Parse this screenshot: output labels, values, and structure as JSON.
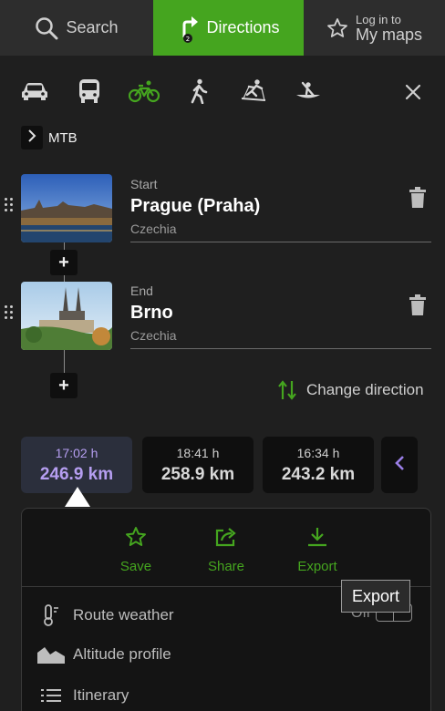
{
  "nav": {
    "search_label": "Search",
    "directions_label": "Directions",
    "login_small": "Log in to",
    "login_big": "My maps",
    "accent_color": "#45a51f"
  },
  "modes": {
    "items": [
      {
        "name": "car",
        "icon": "car-icon",
        "active": false
      },
      {
        "name": "public transport",
        "icon": "bus-icon",
        "active": false
      },
      {
        "name": "bike",
        "icon": "bike-icon",
        "active": true
      },
      {
        "name": "walk",
        "icon": "walk-icon",
        "active": false
      },
      {
        "name": "ski",
        "icon": "ski-icon",
        "active": false
      },
      {
        "name": "boat",
        "icon": "canoe-icon",
        "active": false
      }
    ],
    "close_icon": "close-icon"
  },
  "profile": {
    "label": "MTB"
  },
  "waypoints": [
    {
      "role": "Start",
      "title": "Prague (Praha)",
      "country": "Czechia"
    },
    {
      "role": "End",
      "title": "Brno",
      "country": "Czechia"
    }
  ],
  "add_label": "+",
  "change_direction": "Change direction",
  "routes": [
    {
      "time": "17:02 h",
      "distance": "246.9 km",
      "active": true
    },
    {
      "time": "18:41 h",
      "distance": "258.9 km",
      "active": false
    },
    {
      "time": "16:34 h",
      "distance": "243.2 km",
      "active": false
    }
  ],
  "actions": {
    "save": "Save",
    "share": "Share",
    "export": "Export"
  },
  "options": {
    "weather": "Route weather",
    "weather_toggle": "Off",
    "altitude": "Altitude profile",
    "itinerary": "Itinerary"
  },
  "tooltip": "Export"
}
